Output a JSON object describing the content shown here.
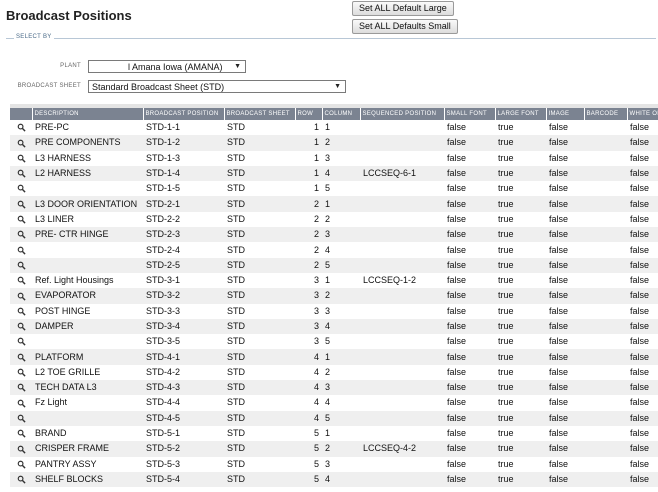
{
  "header": {
    "title": "Broadcast Positions",
    "btn_large": "Set ALL Default Large",
    "btn_small": "Set ALL Defaults Small"
  },
  "select_by": {
    "legend": "SELECT BY",
    "plant_label": "PLANT",
    "plant_value": "l Amana Iowa (AMANA)",
    "sheet_label": "BROADCAST SHEET",
    "sheet_value": "Standard Broadcast Sheet (STD)"
  },
  "grid": {
    "columns": [
      "DESCRIPTION",
      "BROADCAST POSITION",
      "BROADCAST SHEET",
      "ROW",
      "COLUMN",
      "SEQUENCED POSITION",
      "SMALL FONT",
      "LARGE FONT",
      "IMAGE",
      "BARCODE",
      "WHITE ON"
    ],
    "rows": [
      [
        "PRE-PC",
        "STD-1-1",
        "STD",
        "1",
        "1",
        "",
        "false",
        "true",
        "false",
        "",
        "false"
      ],
      [
        "PRE COMPONENTS",
        "STD-1-2",
        "STD",
        "1",
        "2",
        "",
        "false",
        "true",
        "false",
        "",
        "false"
      ],
      [
        "L3 HARNESS",
        "STD-1-3",
        "STD",
        "1",
        "3",
        "",
        "false",
        "true",
        "false",
        "",
        "false"
      ],
      [
        "L2 HARNESS",
        "STD-1-4",
        "STD",
        "1",
        "4",
        "LCCSEQ-6-1",
        "false",
        "true",
        "false",
        "",
        "false"
      ],
      [
        "",
        "STD-1-5",
        "STD",
        "1",
        "5",
        "",
        "false",
        "true",
        "false",
        "",
        "false"
      ],
      [
        "L3 DOOR ORIENTATION",
        "STD-2-1",
        "STD",
        "2",
        "1",
        "",
        "false",
        "true",
        "false",
        "",
        "false"
      ],
      [
        "L3 LINER",
        "STD-2-2",
        "STD",
        "2",
        "2",
        "",
        "false",
        "true",
        "false",
        "",
        "false"
      ],
      [
        "PRE- CTR HINGE",
        "STD-2-3",
        "STD",
        "2",
        "3",
        "",
        "false",
        "true",
        "false",
        "",
        "false"
      ],
      [
        "",
        "STD-2-4",
        "STD",
        "2",
        "4",
        "",
        "false",
        "true",
        "false",
        "",
        "false"
      ],
      [
        "",
        "STD-2-5",
        "STD",
        "2",
        "5",
        "",
        "false",
        "true",
        "false",
        "",
        "false"
      ],
      [
        "Ref. Light Housings",
        "STD-3-1",
        "STD",
        "3",
        "1",
        "LCCSEQ-1-2",
        "false",
        "true",
        "false",
        "",
        "false"
      ],
      [
        "EVAPORATOR",
        "STD-3-2",
        "STD",
        "3",
        "2",
        "",
        "false",
        "true",
        "false",
        "",
        "false"
      ],
      [
        "POST HINGE",
        "STD-3-3",
        "STD",
        "3",
        "3",
        "",
        "false",
        "true",
        "false",
        "",
        "false"
      ],
      [
        "DAMPER",
        "STD-3-4",
        "STD",
        "3",
        "4",
        "",
        "false",
        "true",
        "false",
        "",
        "false"
      ],
      [
        "",
        "STD-3-5",
        "STD",
        "3",
        "5",
        "",
        "false",
        "true",
        "false",
        "",
        "false"
      ],
      [
        "PLATFORM",
        "STD-4-1",
        "STD",
        "4",
        "1",
        "",
        "false",
        "true",
        "false",
        "",
        "false"
      ],
      [
        "L2 TOE GRILLE",
        "STD-4-2",
        "STD",
        "4",
        "2",
        "",
        "false",
        "true",
        "false",
        "",
        "false"
      ],
      [
        "TECH DATA L3",
        "STD-4-3",
        "STD",
        "4",
        "3",
        "",
        "false",
        "true",
        "false",
        "",
        "false"
      ],
      [
        "Fz Light",
        "STD-4-4",
        "STD",
        "4",
        "4",
        "",
        "false",
        "true",
        "false",
        "",
        "false"
      ],
      [
        "",
        "STD-4-5",
        "STD",
        "4",
        "5",
        "",
        "false",
        "true",
        "false",
        "",
        "false"
      ],
      [
        "BRAND",
        "STD-5-1",
        "STD",
        "5",
        "1",
        "",
        "false",
        "true",
        "false",
        "",
        "false"
      ],
      [
        "CRISPER FRAME",
        "STD-5-2",
        "STD",
        "5",
        "2",
        "LCCSEQ-4-2",
        "false",
        "true",
        "false",
        "",
        "false"
      ],
      [
        "PANTRY ASSY",
        "STD-5-3",
        "STD",
        "5",
        "3",
        "",
        "false",
        "true",
        "false",
        "",
        "false"
      ],
      [
        "SHELF BLOCKS",
        "STD-5-4",
        "STD",
        "5",
        "4",
        "",
        "false",
        "true",
        "false",
        "",
        "false"
      ]
    ]
  },
  "colors": {
    "header_bg": "#7b8391",
    "row_alt": "#efefef",
    "legend": "#4a6a88"
  },
  "icons": {
    "row_action": "magnifier-icon",
    "dropdown": "chevron-down-icon"
  }
}
